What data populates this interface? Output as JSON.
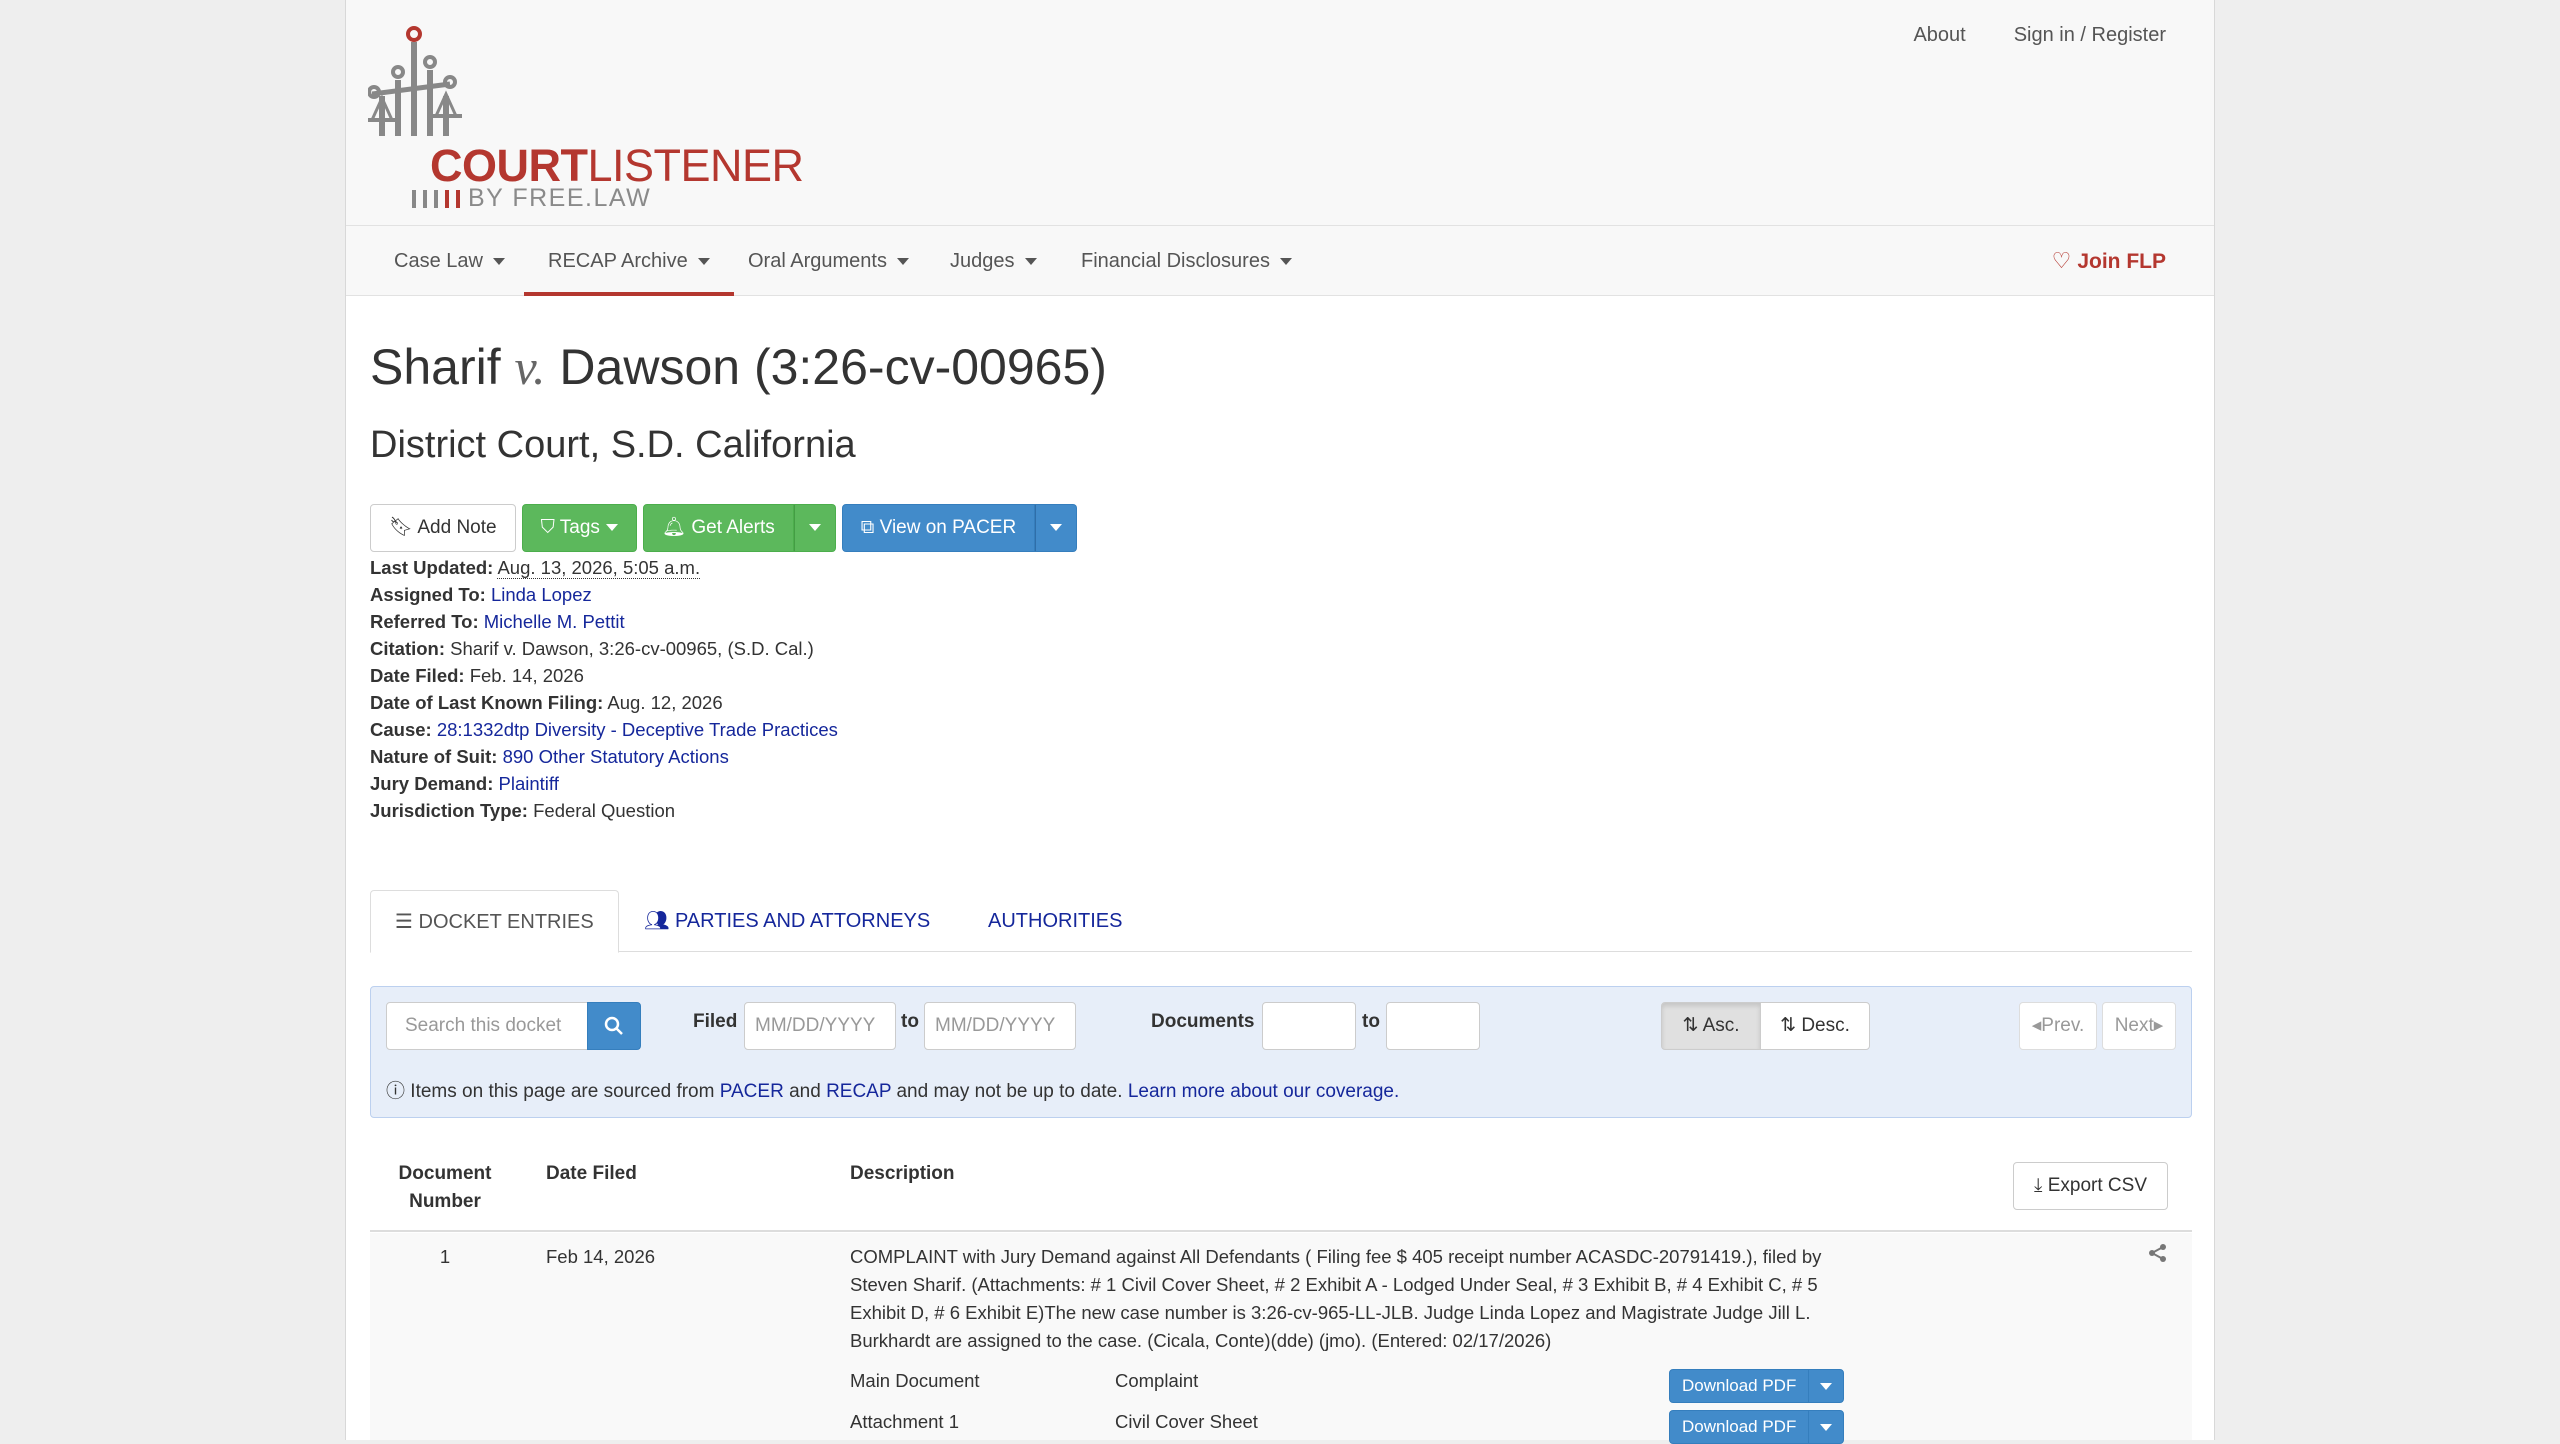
{
  "header": {
    "logo_court": "COURT",
    "logo_listener": "LISTENER",
    "logo_sub": "BY FREE.LAW",
    "links": [
      "About",
      "Sign in / Register"
    ]
  },
  "nav": {
    "items": [
      "Case Law",
      "RECAP Archive",
      "Oral Arguments",
      "Judges",
      "Financial Disclosures"
    ],
    "active": "RECAP Archive",
    "join": "Join FLP"
  },
  "case": {
    "title_left": "Sharif",
    "title_v": "v.",
    "title_right": "Dawson (3:26-cv-00965)",
    "court": "District Court, S.D. California"
  },
  "buttons": {
    "add_note": "Add Note",
    "tags": "Tags",
    "get_alerts": "Get Alerts",
    "view_pacer": "View on PACER"
  },
  "meta": {
    "last_updated_label": "Last Updated:",
    "last_updated": "Aug. 13, 2026, 5:05 a.m.",
    "assigned_label": "Assigned To:",
    "assigned": "Linda Lopez",
    "referred_label": "Referred To:",
    "referred": "Michelle M. Pettit",
    "citation_label": "Citation:",
    "citation": "Sharif v. Dawson, 3:26-cv-00965, (S.D. Cal.)",
    "date_filed_label": "Date Filed:",
    "date_filed": "Feb. 14, 2026",
    "last_filing_label": "Date of Last Known Filing:",
    "last_filing": "Aug. 12, 2026",
    "cause_label": "Cause:",
    "cause": "28:1332dtp Diversity - Deceptive Trade Practices",
    "nature_label": "Nature of Suit:",
    "nature": "890 Other Statutory Actions",
    "jury_label": "Jury Demand:",
    "jury": "Plaintiff",
    "jurisdiction_label": "Jurisdiction Type:",
    "jurisdiction": "Federal Question"
  },
  "tabs": [
    "DOCKET ENTRIES",
    "PARTIES AND ATTORNEYS",
    "AUTHORITIES"
  ],
  "filters": {
    "search_placeholder": "Search this docket",
    "filed_label": "Filed",
    "date_placeholder": "MM/DD/YYYY",
    "to_label": "to",
    "documents_label": "Documents",
    "asc": "Asc.",
    "desc": "Desc.",
    "prev": "Prev.",
    "next": "Next",
    "notice_1": "Items on this page are sourced from",
    "notice_pacer": "PACER",
    "notice_and": "and",
    "notice_recap": "RECAP",
    "notice_2": "and may not be up to date.",
    "notice_link": "Learn more about our coverage."
  },
  "table": {
    "col_doc_1": "Document",
    "col_doc_2": "Number",
    "col_date": "Date Filed",
    "col_desc": "Description",
    "export": "Export CSV",
    "rows": [
      {
        "number": "1",
        "date": "Feb 14, 2026",
        "desc_lines": [
          "COMPLAINT with Jury Demand against All Defendants ( Filing fee $ 405 receipt number ACASDC-20791419.), filed by",
          "Steven Sharif. (Attachments: # 1 Civil Cover Sheet, # 2 Exhibit A - Lodged Under Seal, # 3 Exhibit B, # 4 Exhibit C, # 5",
          "Exhibit D, # 6 Exhibit E)The new case number is 3:26-cv-965-LL-JLB. Judge Linda Lopez and Magistrate Judge Jill L.",
          "Burkhardt are assigned to the case. (Cicala, Conte)(dde) (jmo). (Entered: 02/17/2026)"
        ],
        "attachments": [
          {
            "name": "Main Document",
            "desc": "Complaint",
            "button": "Download PDF"
          },
          {
            "name": "Attachment 1",
            "desc": "Civil Cover Sheet",
            "button": "Download PDF"
          }
        ]
      }
    ]
  },
  "colors": {
    "brand_red": "#b4372f",
    "green": "#5cb85c",
    "blue": "#428bca",
    "link": "#15279b"
  }
}
